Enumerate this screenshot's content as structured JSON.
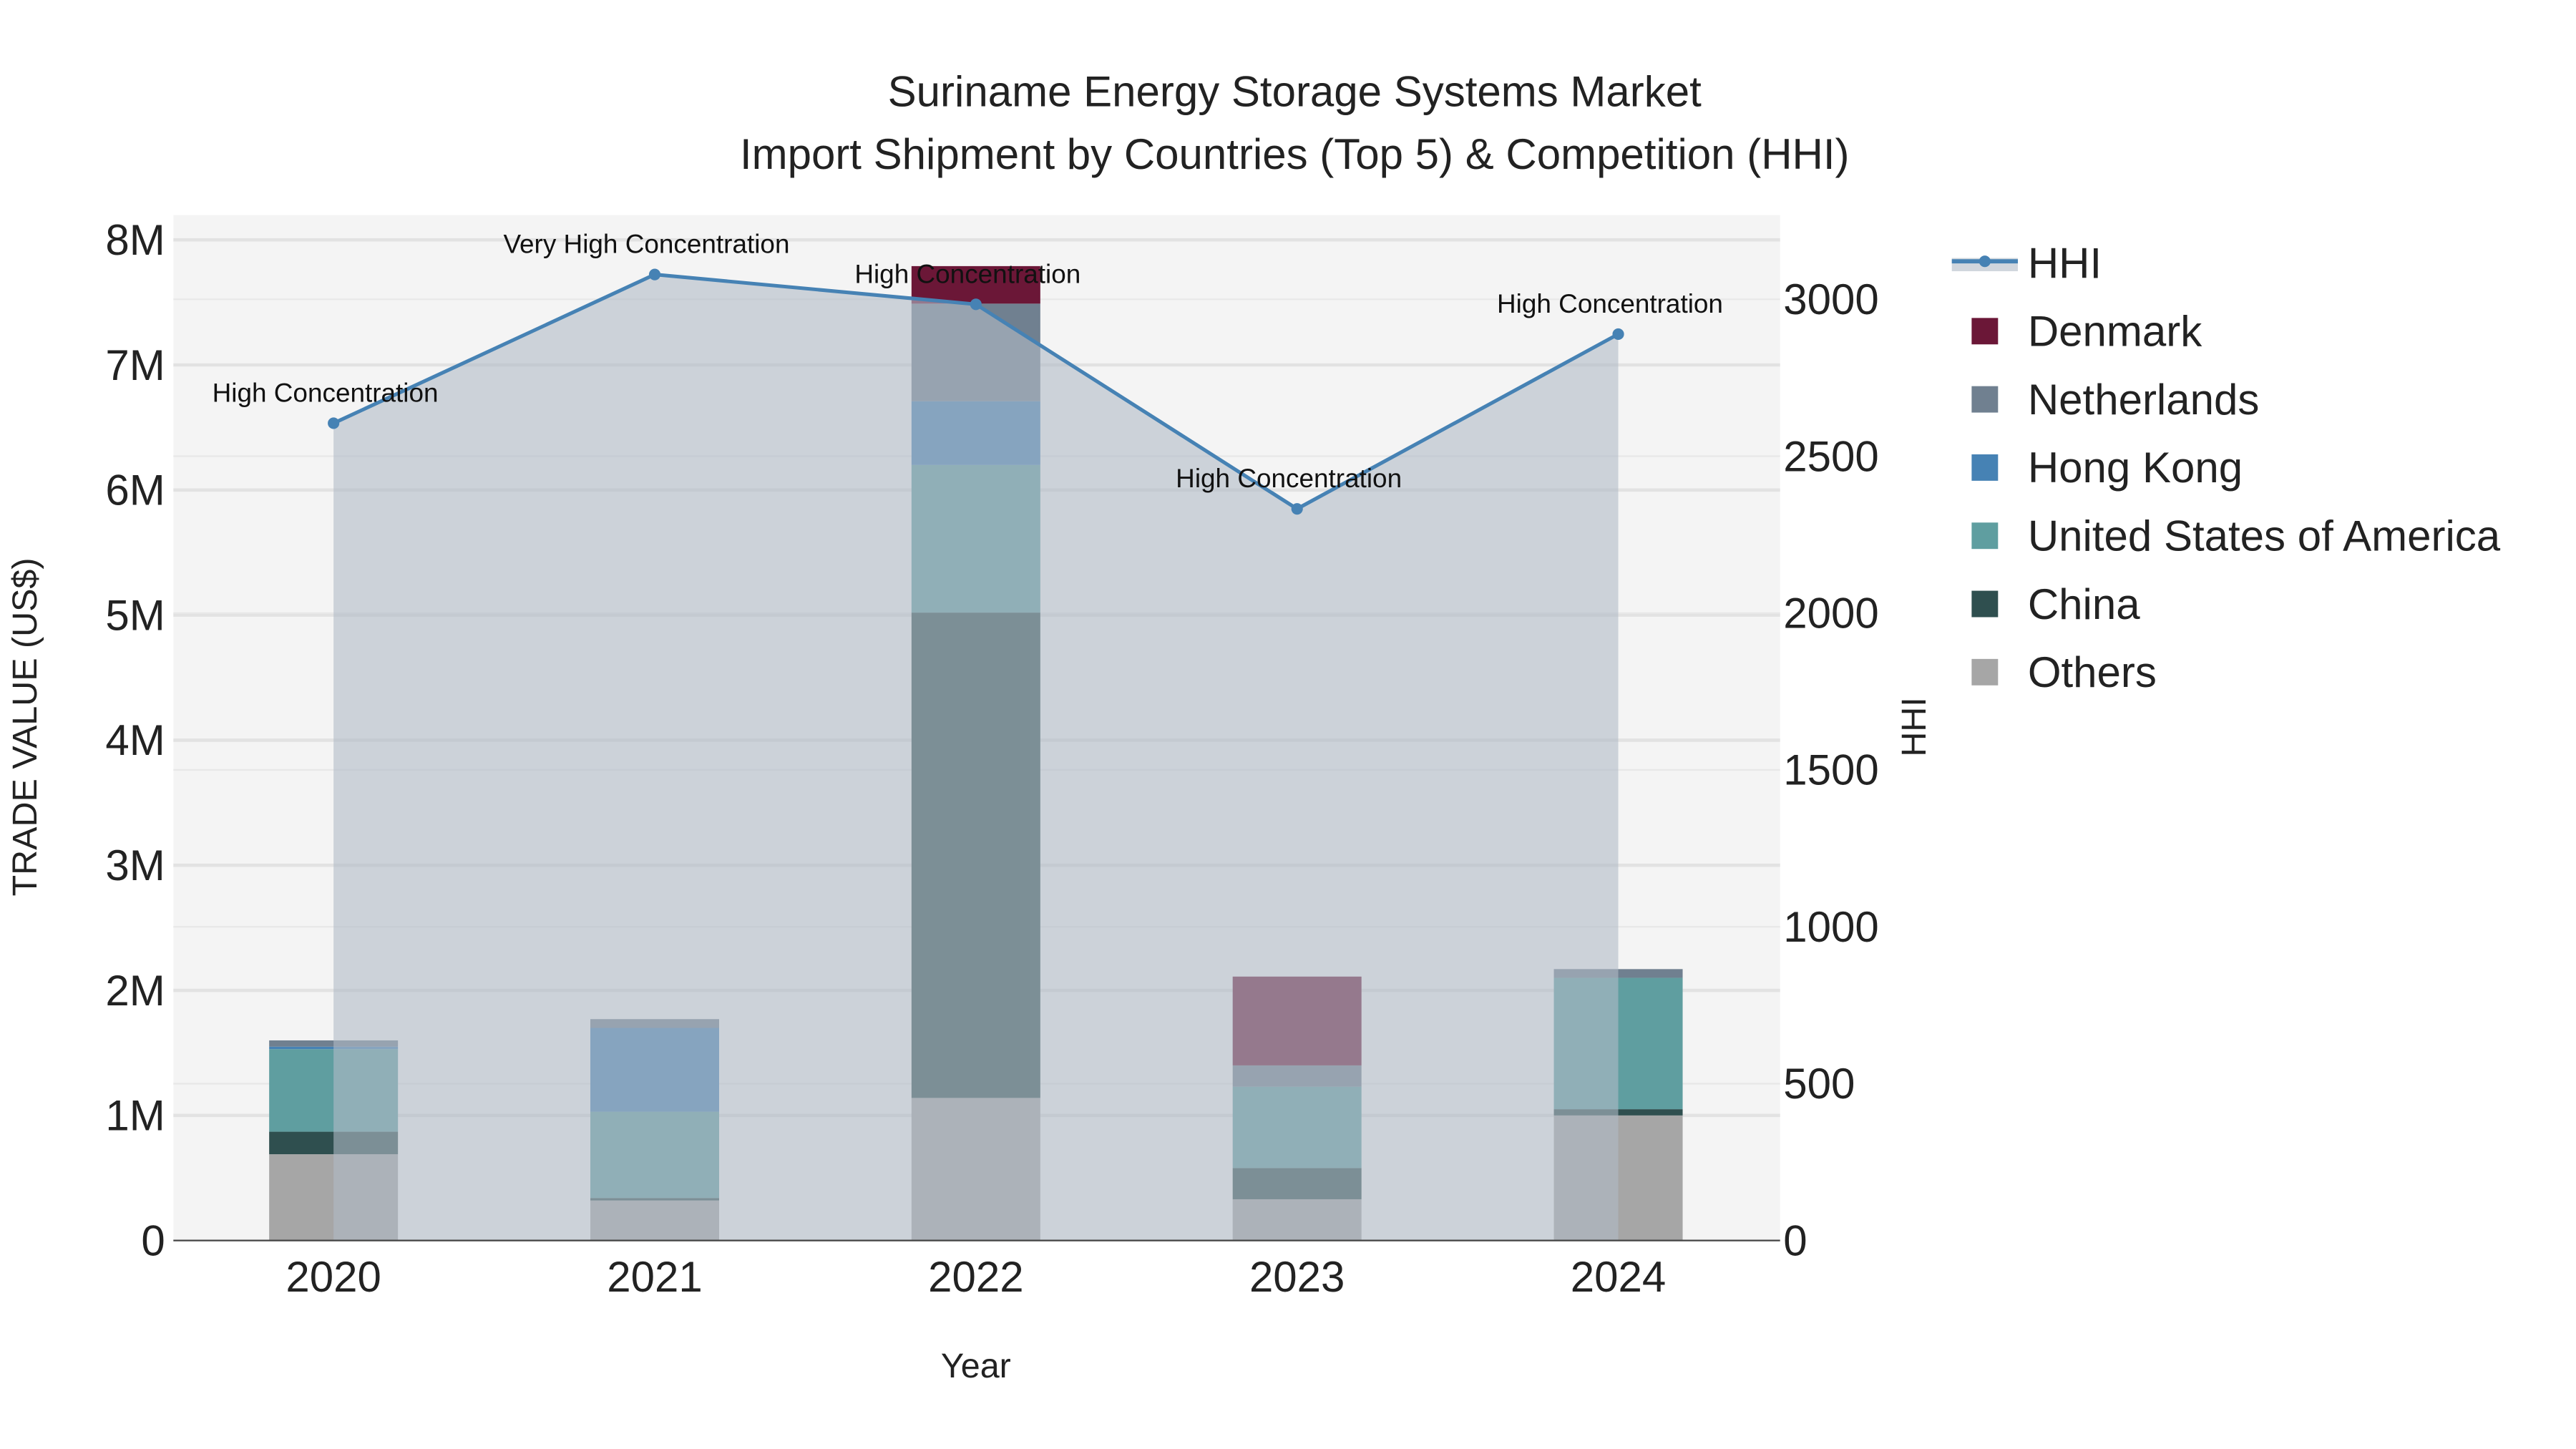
{
  "chart_data": {
    "type": "bar",
    "title": "Suriname Energy Storage Systems Market",
    "subtitle": "Import Shipment by Countries (Top 5) & Competition (HHI)",
    "xlabel": "Year",
    "ylabel": "TRADE VALUE (US$)",
    "y2label": "HHI",
    "categories": [
      "2020",
      "2021",
      "2022",
      "2023",
      "2024"
    ],
    "ylim": [
      0,
      8000000
    ],
    "y_ticks": [
      0,
      1000000,
      2000000,
      3000000,
      4000000,
      5000000,
      6000000,
      7000000,
      8000000
    ],
    "y_tick_labels": [
      "0",
      "1M",
      "2M",
      "3M",
      "4M",
      "5M",
      "6M",
      "7M",
      "8M"
    ],
    "y2lim": [
      0,
      3250
    ],
    "y2_ticks": [
      0,
      500,
      1000,
      1500,
      2000,
      2500,
      3000
    ],
    "y2_tick_labels": [
      "0",
      "500",
      "1000",
      "1500",
      "2000",
      "2500",
      "3000"
    ],
    "grid": true,
    "legend_position": "right",
    "series": [
      {
        "name": "Others",
        "color": "#a6a6a6",
        "values": [
          690000,
          320000,
          1140000,
          330000,
          1000000
        ]
      },
      {
        "name": "China",
        "color": "#2f4f4f",
        "values": [
          180000,
          20000,
          3880000,
          250000,
          50000
        ]
      },
      {
        "name": "United States of America",
        "color": "#5f9ea0",
        "values": [
          660000,
          690000,
          1180000,
          650000,
          1050000
        ]
      },
      {
        "name": "Hong Kong",
        "color": "#4682b4",
        "values": [
          20000,
          670000,
          510000,
          0,
          0
        ]
      },
      {
        "name": "Netherlands",
        "color": "#708090",
        "values": [
          50000,
          70000,
          780000,
          170000,
          70000
        ]
      },
      {
        "name": "Denmark",
        "color": "#6b1737",
        "values": [
          0,
          0,
          300000,
          710000,
          0
        ]
      }
    ],
    "hhi": {
      "name": "HHI",
      "color": "#4682b4",
      "values": [
        2605,
        3079,
        2984,
        2332,
        2889
      ],
      "annotations": [
        "High Concentration",
        "Very High Concentration",
        "High Concentration",
        "High Concentration",
        "High Concentration"
      ]
    },
    "legend_order": [
      "HHI",
      "Denmark",
      "Netherlands",
      "Hong Kong",
      "United States of America",
      "China",
      "Others"
    ]
  }
}
